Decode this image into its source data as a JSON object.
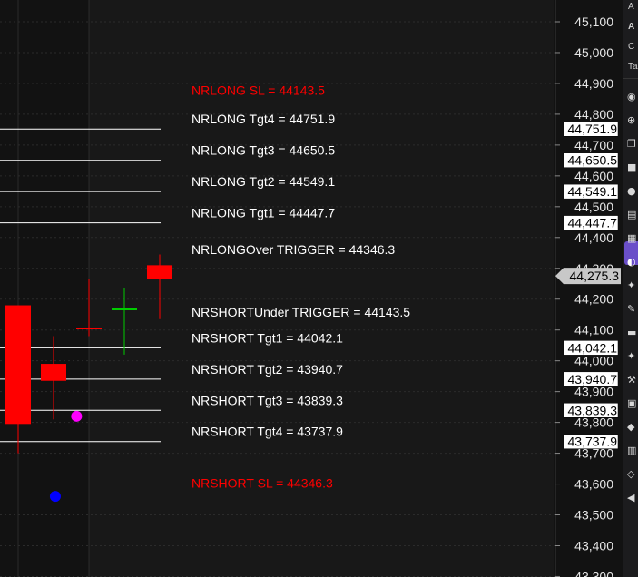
{
  "chart_data": {
    "type": "candlestick",
    "ylim": [
      43300,
      45130
    ],
    "y_ticks": [
      45100,
      45000,
      44900,
      44800,
      44700,
      44600,
      44500,
      44400,
      44300,
      44200,
      44100,
      44000,
      43900,
      43800,
      43700,
      43600,
      43500,
      43400,
      43300
    ],
    "y_tick_labels": [
      "45,100",
      "45,000",
      "44,900",
      "44,800",
      "44,700",
      "44,600",
      "44,500",
      "44,400",
      "44,300",
      "44,200",
      "44,100",
      "44,000",
      "43,900",
      "43,800",
      "43,700",
      "43,600",
      "43,500",
      "43,400",
      "43,300"
    ],
    "candles": [
      {
        "open": 44180,
        "high": 44180,
        "low": 43700,
        "close": 43795,
        "color": "#ff0000"
      },
      {
        "open": 43990,
        "high": 44080,
        "low": 43810,
        "close": 43935,
        "color": "#ff0000"
      },
      {
        "open": 44105,
        "high": 44265,
        "low": 44080,
        "close": 44105,
        "color": "#ff0000"
      },
      {
        "open": 44162,
        "high": 44235,
        "low": 44020,
        "close": 44167,
        "color": "#00cc00"
      },
      {
        "open": 44310,
        "high": 44345,
        "low": 44135,
        "close": 44265,
        "color": "#ff0000"
      }
    ],
    "markers": [
      {
        "candle_index": 1.65,
        "value": 43820,
        "color": "#ff00ff"
      },
      {
        "candle_index": 1.05,
        "value": 43560,
        "color": "#0000ff"
      }
    ],
    "levels": [
      {
        "label": "NRLONG SL = 44143.5",
        "label_value": 44875,
        "line": false,
        "color": "#ff0000"
      },
      {
        "label": "NRLONG Tgt4 = 44751.9",
        "value": 44751.9,
        "line": true,
        "color": "#ffffff",
        "tag": "44,751.9"
      },
      {
        "label": "NRLONG Tgt3 = 44650.5",
        "value": 44650.5,
        "line": true,
        "color": "#ffffff",
        "tag": "44,650.5"
      },
      {
        "label": "NRLONG Tgt2 = 44549.1",
        "value": 44549.1,
        "line": true,
        "color": "#ffffff",
        "tag": "44,549.1"
      },
      {
        "label": "NRLONG Tgt1 = 44447.7",
        "value": 44447.7,
        "line": true,
        "color": "#ffffff",
        "tag": "44,447.7"
      },
      {
        "label": "NRLONGOver TRIGGER = 44346.3",
        "value": 44346.3,
        "line": false,
        "color": "#ffffff"
      },
      {
        "label": "NRSHORTUnder TRIGGER = 44143.5",
        "value": 44143.5,
        "line": false,
        "color": "#ffffff"
      },
      {
        "label": "NRSHORT Tgt1 = 44042.1",
        "value": 44042.1,
        "line": true,
        "color": "#ffffff",
        "tag": "44,042.1"
      },
      {
        "label": "NRSHORT Tgt2 = 43940.7",
        "value": 43940.7,
        "line": true,
        "color": "#ffffff",
        "tag": "43,940.7"
      },
      {
        "label": "NRSHORT Tgt3 = 43839.3",
        "value": 43839.3,
        "line": true,
        "color": "#ffffff",
        "tag": "43,839.3"
      },
      {
        "label": "NRSHORT Tgt4 = 43737.9",
        "value": 43737.9,
        "line": true,
        "color": "#ffffff",
        "tag": "43,737.9"
      },
      {
        "label": "NRSHORT SL = 44346.3",
        "label_value": 43600,
        "line": false,
        "color": "#ff0000"
      }
    ],
    "last_price": {
      "value": 44275.3,
      "tag": "44,275.3",
      "color": "#c8c8c8"
    }
  },
  "sidebar": {
    "header_items": [
      "A",
      "A",
      "C",
      "Ta"
    ],
    "icons": [
      "pin-icon",
      "link-icon",
      "copy-icon",
      "chat-icon",
      "alert-icon",
      "window-icon",
      "layers-icon",
      "avatar-icon",
      "pencil-icon",
      "edit-icon",
      "bookmark-icon",
      "brush-icon",
      "wrench-icon",
      "list-icon",
      "shield-icon",
      "bar-chart-icon",
      "diamond-icon",
      "back-icon"
    ],
    "active_index": 7
  },
  "colors": {
    "background": "#121212",
    "grid": "#2b2b2b",
    "axis_border": "#3a3a3a",
    "bear": "#ff0000",
    "bull": "#00cc00",
    "level_line": "#ffffff",
    "sl_text": "#ff0000"
  }
}
